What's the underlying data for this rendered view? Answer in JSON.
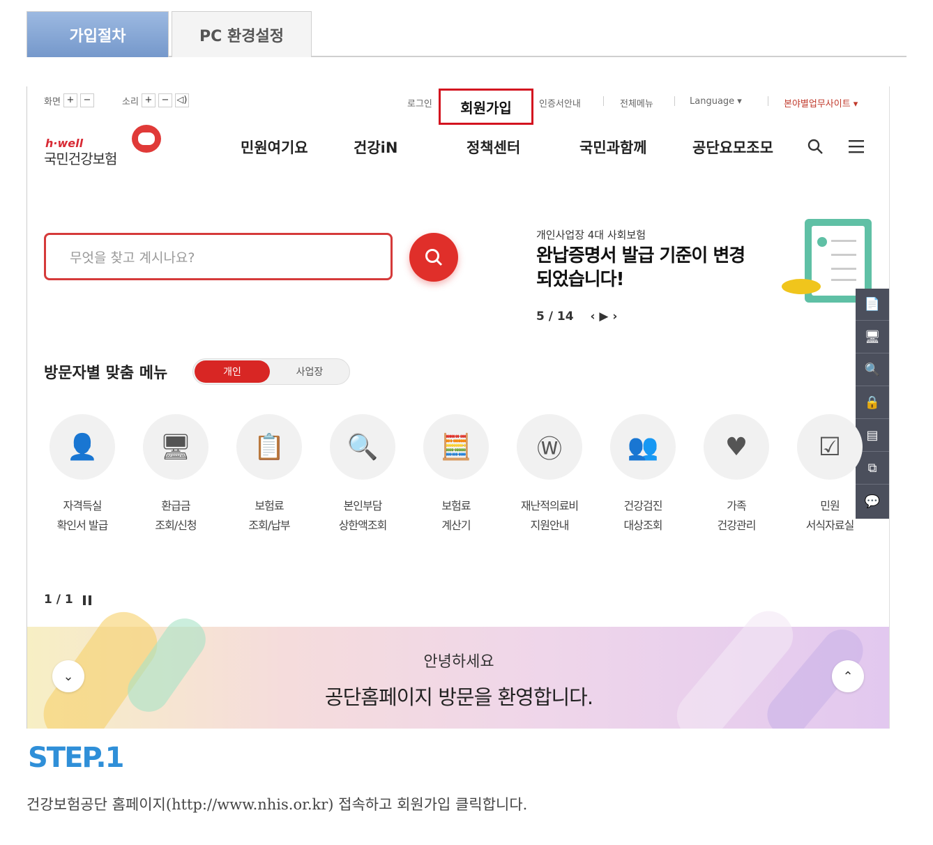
{
  "tabs": [
    {
      "label": "가입절차",
      "active": true
    },
    {
      "label": "PC 환경설정",
      "active": false
    }
  ],
  "site": {
    "util": {
      "screen": "화면",
      "sound": "소리",
      "plus": "+",
      "minus": "−",
      "speaker": "◁)"
    },
    "top_links": {
      "login": "로그인",
      "join": "회원가입",
      "cert": "인증서안내",
      "allmenu": "전체메뉴",
      "language": "Language ▾",
      "business": "본야별업무사이트 ▾"
    },
    "logo": {
      "en": "h·well",
      "ko": "국민건강보험"
    },
    "gnb": [
      "민원여기요",
      "건강iN",
      "정책센터",
      "국민과함께",
      "공단요모조모"
    ],
    "search": {
      "placeholder": "무엇을 찾고 계시나요?"
    },
    "banner": {
      "sub": "개인사업장 4대 사회보험",
      "title": "완납증명서 발급 기준이 변경되었습니다!",
      "pager": "5 / 14",
      "nav": "‹  ▶  ›"
    },
    "quick_icons": [
      "📄",
      "🖥",
      "🔍",
      "🔒",
      "▤",
      "⧉",
      "💬"
    ],
    "visit": {
      "title": "방문자별 맞춤 메뉴",
      "personal": "개인",
      "business": "사업장"
    },
    "menu": [
      {
        "line1": "자격득실",
        "line2": "확인서 발급",
        "icon": "👤"
      },
      {
        "line1": "환급금",
        "line2": "조회/신청",
        "icon": "🖥"
      },
      {
        "line1": "보험료",
        "line2": "조회/납부",
        "icon": "📋"
      },
      {
        "line1": "본인부담",
        "line2": "상한액조회",
        "icon": "🔍"
      },
      {
        "line1": "보험료",
        "line2": "계산기",
        "icon": "🧮"
      },
      {
        "line1": "재난적의료비",
        "line2": "지원안내",
        "icon": "Ⓦ"
      },
      {
        "line1": "건강검진",
        "line2": "대상조회",
        "icon": "👥"
      },
      {
        "line1": "가족",
        "line2": "건강관리",
        "icon": "♥"
      },
      {
        "line1": "민원",
        "line2": "서식자료실",
        "icon": "☑"
      }
    ],
    "page_indicator": "1 / 1",
    "footer": {
      "hello": "안녕하세요",
      "welcome": "공단홈페이지 방문을 환영합니다.",
      "down": "⌄",
      "up": "⌃"
    }
  },
  "step": {
    "title": "STEP.1",
    "desc": "건강보험공단 홈페이지(http://www.nhis.or.kr) 접속하고 회원가입 클릭합니다."
  }
}
